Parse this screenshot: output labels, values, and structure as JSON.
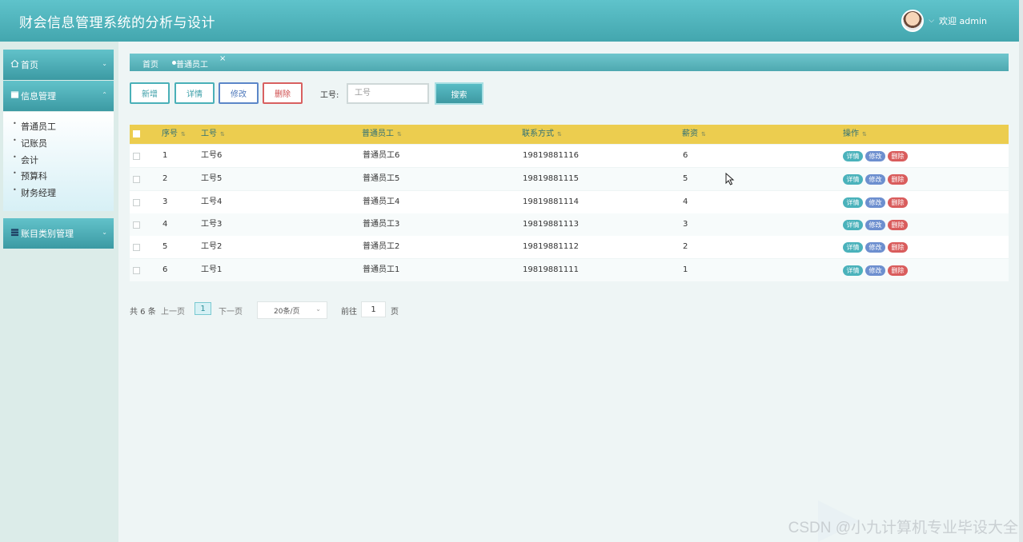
{
  "header": {
    "title": "财会信息管理系统的分析与设计",
    "welcome": "欢迎 admin"
  },
  "sidebar": {
    "menus": [
      {
        "label": "首页",
        "icon": "home-icon"
      },
      {
        "label": "信息管理",
        "icon": "document-icon"
      },
      {
        "label": "账目类别管理",
        "icon": "list-icon"
      }
    ],
    "submenu": [
      "普通员工",
      "记账员",
      "会计",
      "预算科",
      "财务经理"
    ]
  },
  "breadcrumb": {
    "home": "首页",
    "current": "普通员工"
  },
  "toolbar": {
    "add": "新增",
    "detail": "详情",
    "edit": "修改",
    "delete": "删除",
    "filter_label": "工号:",
    "filter_placeholder": "工号",
    "search": "搜索"
  },
  "table": {
    "headers": [
      "序号",
      "工号",
      "普通员工",
      "联系方式",
      "薪资",
      "操作"
    ],
    "rows": [
      {
        "no": "1",
        "id": "工号6",
        "name": "普通员工6",
        "phone": "19819881116",
        "salary": "6"
      },
      {
        "no": "2",
        "id": "工号5",
        "name": "普通员工5",
        "phone": "19819881115",
        "salary": "5"
      },
      {
        "no": "3",
        "id": "工号4",
        "name": "普通员工4",
        "phone": "19819881114",
        "salary": "4"
      },
      {
        "no": "4",
        "id": "工号3",
        "name": "普通员工3",
        "phone": "19819881113",
        "salary": "3"
      },
      {
        "no": "5",
        "id": "工号2",
        "name": "普通员工2",
        "phone": "19819881112",
        "salary": "2"
      },
      {
        "no": "6",
        "id": "工号1",
        "name": "普通员工1",
        "phone": "19819881111",
        "salary": "1"
      }
    ],
    "row_actions": {
      "detail": "详情",
      "edit": "修改",
      "delete": "删除"
    }
  },
  "pagination": {
    "total": "共 6 条",
    "prev": "上一页",
    "current_page": "1",
    "next": "下一页",
    "page_size": "20条/页",
    "goto_label": "前往",
    "goto_value": "1",
    "page_unit": "页"
  },
  "watermark": "CSDN @小九计算机专业毕设大全"
}
